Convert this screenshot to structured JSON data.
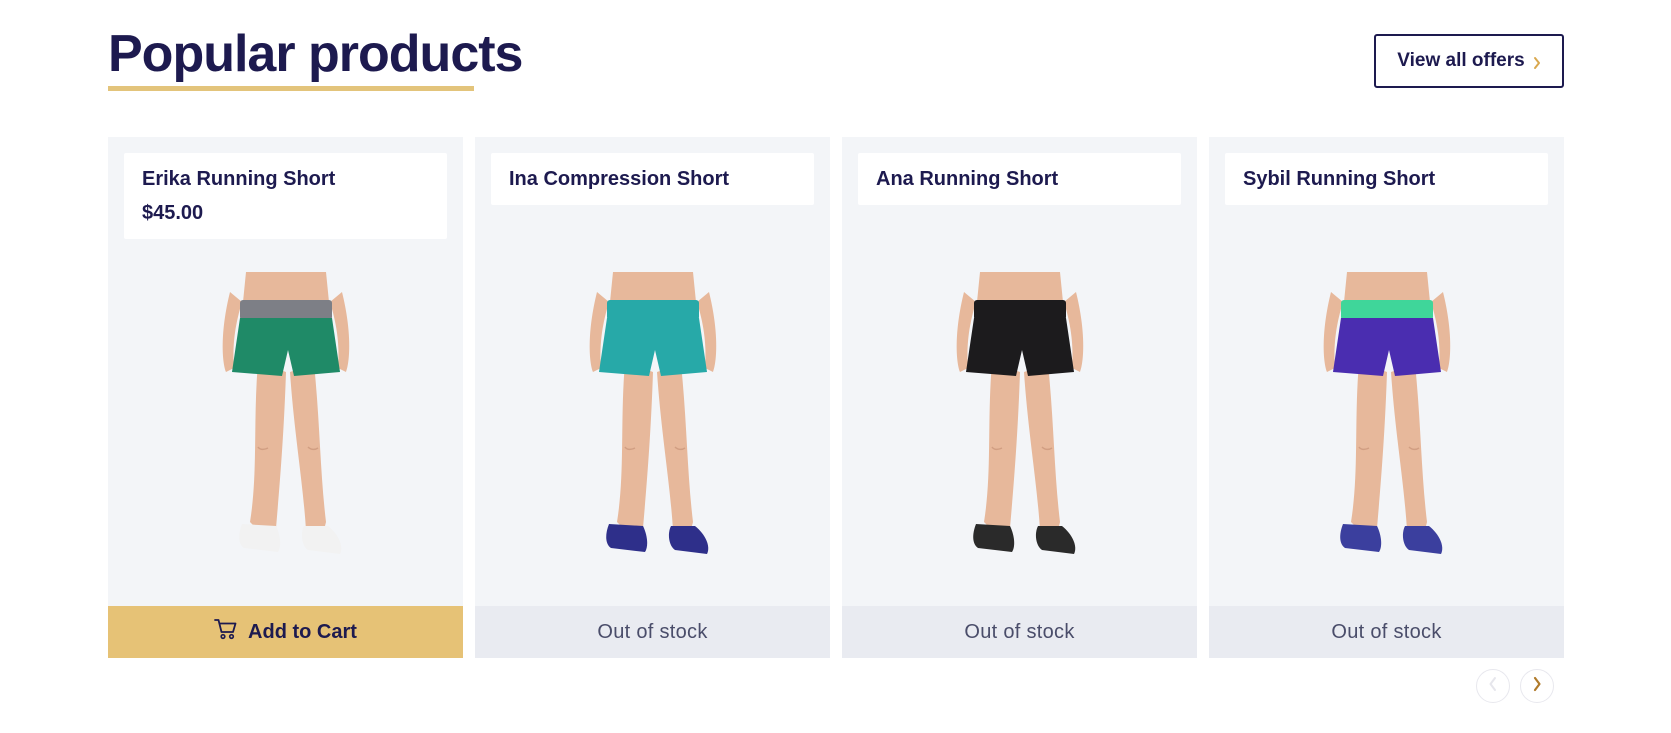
{
  "header": {
    "title": "Popular products",
    "view_all_label": "View all offers"
  },
  "colors": {
    "brand_navy": "#1d1a4f",
    "accent_gold": "#e6c276",
    "underline_gold": "#e3c47b",
    "card_bg": "#f3f5f8",
    "out_of_stock_bg": "#e9ebf1"
  },
  "products": [
    {
      "name": "Erika Running Short",
      "price": "$45.00",
      "action": "Add to Cart",
      "in_stock": true,
      "image_icon": "green-running-shorts-model",
      "shorts_color": "#1f8a67",
      "waist_color": "#7d7f86",
      "shoe_color": "#f2f2f2"
    },
    {
      "name": "Ina Compression Short",
      "action": "Out of stock",
      "in_stock": false,
      "image_icon": "teal-compression-shorts-model",
      "shorts_color": "#27a9a8",
      "waist_color": "#27a9a8",
      "shoe_color": "#2e2f8a"
    },
    {
      "name": "Ana Running Short",
      "action": "Out of stock",
      "in_stock": false,
      "image_icon": "black-running-shorts-model",
      "shorts_color": "#1c1b1d",
      "waist_color": "#1c1b1d",
      "shoe_color": "#2a2a2a"
    },
    {
      "name": "Sybil Running Short",
      "action": "Out of stock",
      "in_stock": false,
      "image_icon": "purple-running-shorts-model",
      "shorts_color": "#4a2db0",
      "waist_color": "#3fd69a",
      "shoe_color": "#3b3f9e"
    }
  ],
  "pager": {
    "prev_icon": "chevron-left-icon",
    "next_icon": "chevron-right-icon"
  }
}
